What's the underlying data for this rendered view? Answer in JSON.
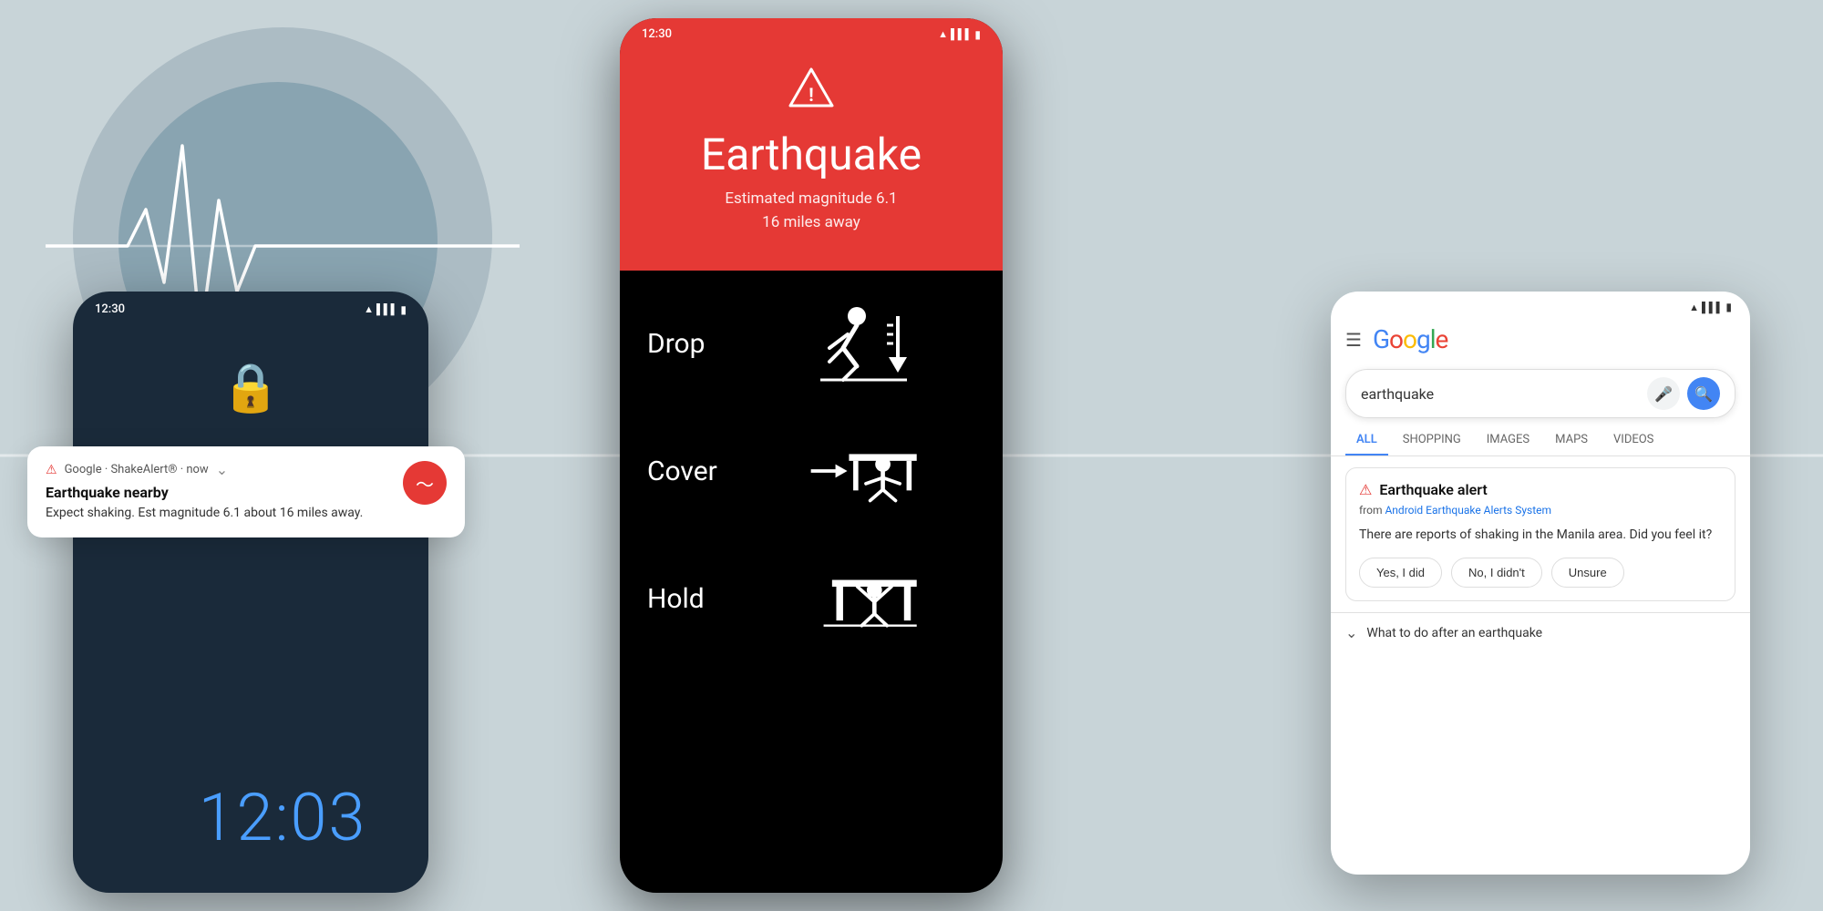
{
  "background": {
    "color": "#c8d4d8"
  },
  "left_phone": {
    "time_display": "12:03",
    "lock_icon": "🔒",
    "notification": {
      "source": "Google · ShakeAlert® · now",
      "triangle": "⚠",
      "title": "Earthquake nearby",
      "body": "Expect shaking. Est magnitude 6.1 about 16 miles away.",
      "chevron": "⌄"
    }
  },
  "center_phone": {
    "status_time": "12:30",
    "alert_title": "Earthquake",
    "alert_subtitle_line1": "Estimated magnitude 6.1",
    "alert_subtitle_line2": "16 miles away",
    "triangle": "▲",
    "instructions": [
      {
        "label": "Drop",
        "action": "drop"
      },
      {
        "label": "Cover",
        "action": "cover"
      },
      {
        "label": "Hold",
        "action": "hold"
      }
    ]
  },
  "right_phone": {
    "search_query": "earthquake",
    "tabs": [
      "ALL",
      "SHOPPING",
      "IMAGES",
      "MAPS",
      "VIDEOS"
    ],
    "active_tab": "ALL",
    "alert_card": {
      "triangle": "⚠",
      "title": "Earthquake alert",
      "source_text": "from ",
      "source_link": "Android Earthquake Alerts System",
      "body": "There are reports of shaking in the Manila area. Did you feel it?",
      "buttons": [
        "Yes, I did",
        "No, I didn't",
        "Unsure"
      ]
    },
    "more_info": {
      "chevron": "⌄",
      "text": "What to do after an earthquake"
    }
  },
  "icons": {
    "wifi": "▲▲",
    "signal": "▌▌▌",
    "battery": "▮"
  }
}
